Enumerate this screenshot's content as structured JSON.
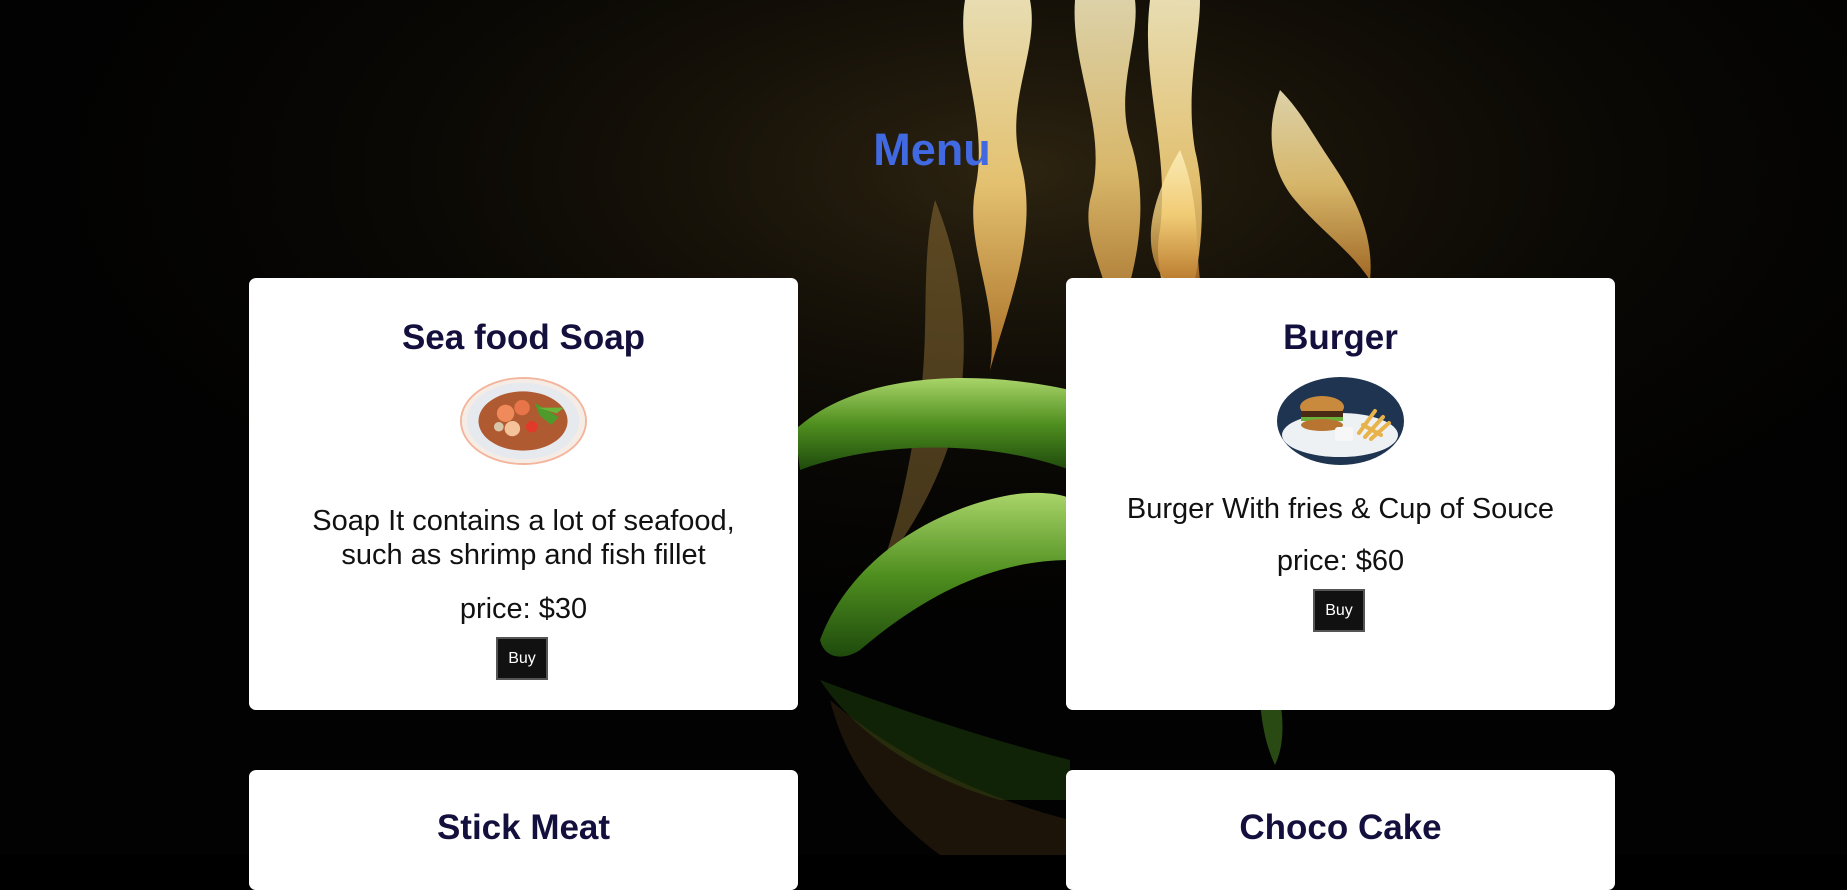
{
  "page": {
    "title": "Menu",
    "title_color": "#4169e1"
  },
  "items": [
    {
      "name": "Sea food Soap",
      "description_line1": "Soap It contains a lot of seafood,",
      "description_line2": "such as shrimp and fish fillet",
      "price": "price: $30",
      "button_label": "Buy"
    },
    {
      "name": "Burger",
      "description_line1": "Burger With fries & Cup of Souce",
      "price": "price: $60",
      "button_label": "Buy"
    },
    {
      "name": "Stick Meat"
    },
    {
      "name": "Choco Cake"
    }
  ]
}
